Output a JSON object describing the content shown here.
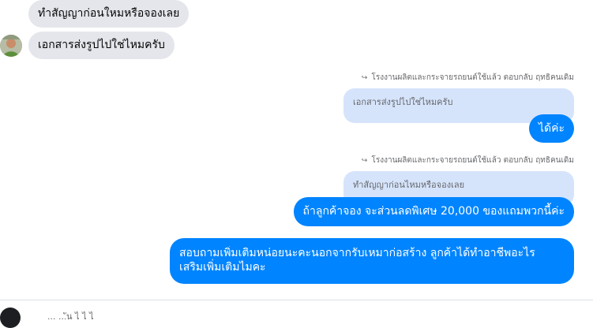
{
  "messages": [
    {
      "text": "ทำสัญญาก่อนใหมหรือจองเลย"
    },
    {
      "text": "เอกสารส่งรูปไปใช่ไหมครับ"
    }
  ],
  "replies": [
    {
      "meta": "โรงงานผลิตและกระจายรถยนต์ใช้แล้ว ตอบกลับ ฤทธิคนเดิม",
      "quoted": "เอกสารส่งรูปไปใช่ไหมครับ",
      "text": "ได้ค่ะ"
    },
    {
      "meta": "โรงงานผลิตและกระจายรถยนต์ใช้แล้ว ตอบกลับ ฤทธิคนเดิม",
      "quoted": "ทำสัญญาก่อนไหมหรือจองเลย",
      "text": "ถ้าลูกค้าจอง จะส่วนลดพิเศษ 20,000 ของแถมพวกนี้ค่ะ"
    }
  ],
  "final_message": {
    "line1": "สอบถามเพิ่มเติมหน่อยนะคะนอกจากรับเหมาก่อสร้าง ลูกค้าได้ทำอาชีพอะไร",
    "line2": "เสริมเพิ่มเติมไมคะ"
  },
  "footer_text": "...  ...ัน ไ  ไ ไ",
  "colors": {
    "incoming_bubble": "#e4e6eb",
    "outgoing_bubble": "#0084ff",
    "quoted_bubble": "#d6e4fb",
    "meta_text": "#65676b"
  },
  "icons": {
    "reply": "reply-arrow-icon"
  }
}
